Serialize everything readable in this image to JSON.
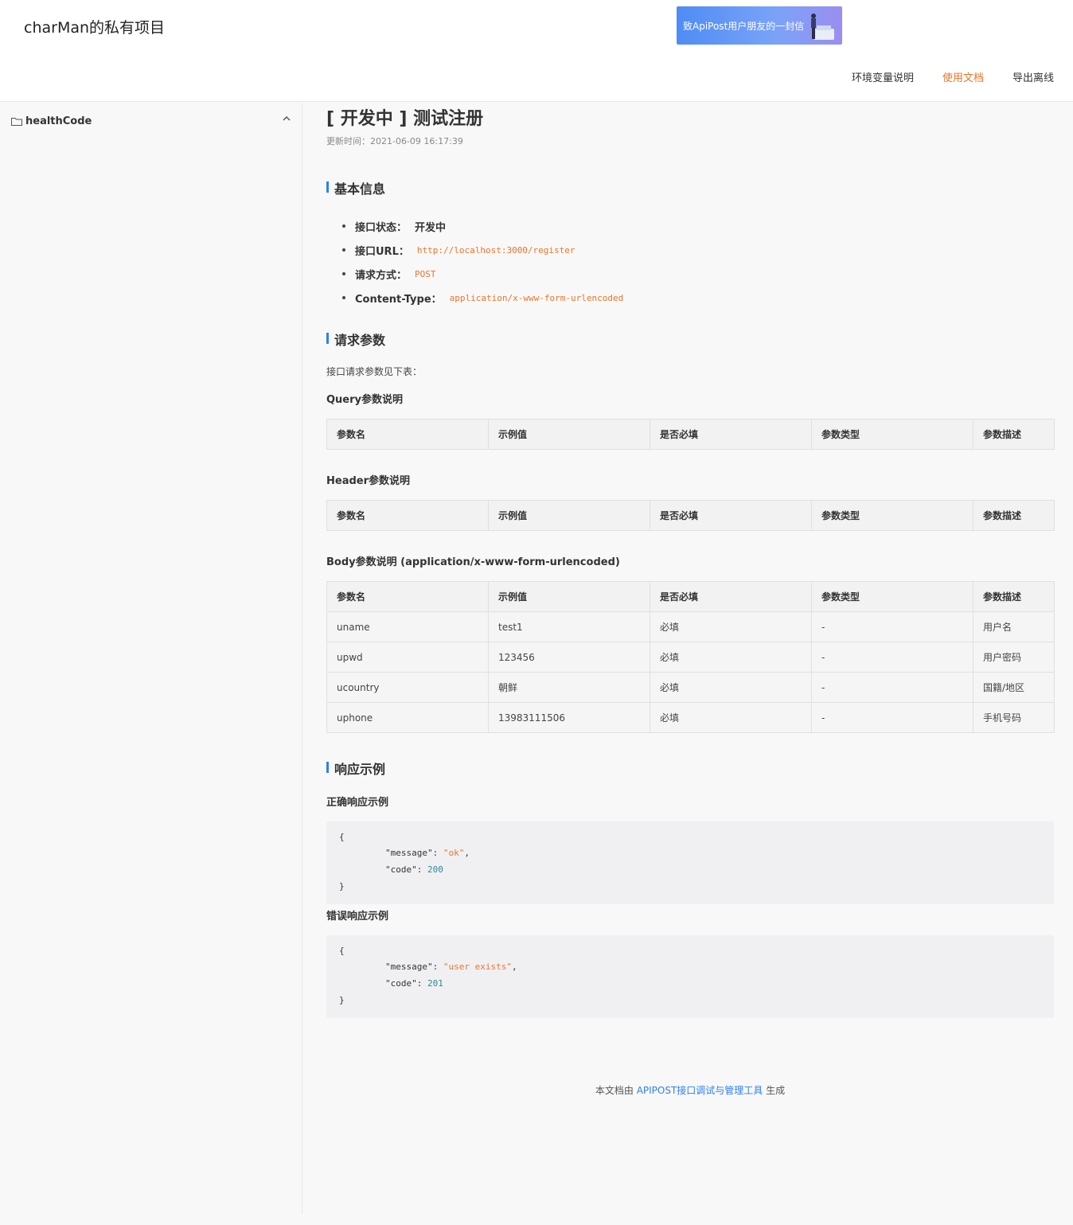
{
  "header": {
    "site_title": "charMan的私有项目",
    "banner_text": "致ApiPost用户朋友的一封信",
    "nav": [
      "环境变量说明",
      "使用文档",
      "导出离线"
    ]
  },
  "sidebar": {
    "folder_label": "healthCode"
  },
  "main": {
    "title": "[ 开发中 ] 测试注册",
    "update_time": "更新时间：2021-06-09 16:17:39",
    "basic_info": {
      "heading": "基本信息",
      "status_key": "接口状态：",
      "status_val": "开发中",
      "url_key": "接口URL：",
      "url_val": "http://localhost:3000/register",
      "method_key": "请求方式：",
      "method_val": "POST",
      "ctype_key": "Content-Type：",
      "ctype_val": "application/x-www-form-urlencoded"
    },
    "request": {
      "heading": "请求参数",
      "desc": "接口请求参数见下表：",
      "query_title": "Query参数说明",
      "header_title": "Header参数说明",
      "body_title": "Body参数说明 (application/x-www-form-urlencoded)",
      "columns": [
        "参数名",
        "示例值",
        "是否必填",
        "参数类型",
        "参数描述"
      ],
      "body_rows": [
        [
          "uname",
          "test1",
          "必填",
          "-",
          "用户名"
        ],
        [
          "upwd",
          "123456",
          "必填",
          "-",
          "用户密码"
        ],
        [
          "ucountry",
          "朝鲜",
          "必填",
          "-",
          "国籍/地区"
        ],
        [
          "uphone",
          "13983111506",
          "必填",
          "-",
          "手机号码"
        ]
      ]
    },
    "response": {
      "heading": "响应示例",
      "ok_title": "正确响应示例",
      "ok": {
        "open": "{",
        "msg_key": "\"message\"",
        "msg_val": "\"ok\"",
        "code_key": "\"code\"",
        "code_val": "200",
        "close": "}"
      },
      "err_title": "错误响应示例",
      "err": {
        "open": "{",
        "msg_key": "\"message\"",
        "msg_val": "\"user exists\"",
        "code_key": "\"code\"",
        "code_val": "201",
        "close": "}"
      }
    },
    "footer": {
      "prefix": "本文档由",
      "link": "APIPOST接口调试与管理工具",
      "suffix": "生成"
    }
  },
  "colors": {
    "accent": "#2f80ed",
    "active_nav": "#e8762d",
    "code_string": "#e8762d"
  }
}
